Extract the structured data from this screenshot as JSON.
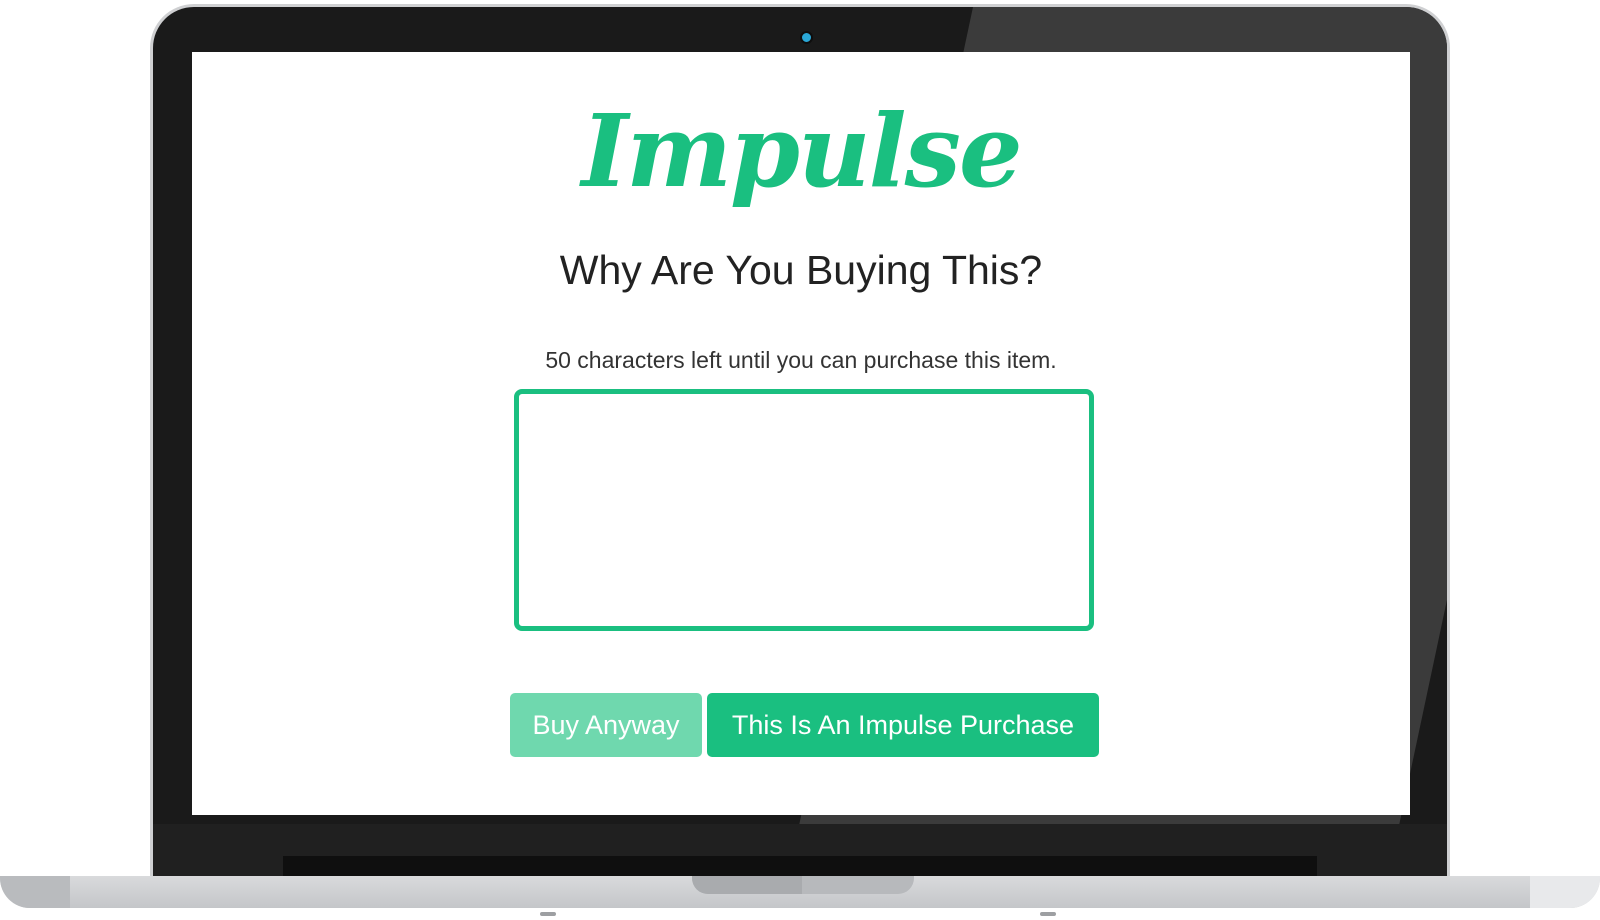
{
  "app": {
    "logo_text": "Impulse",
    "brand_color": "#1abf80",
    "brand_color_light": "#6fd8ae"
  },
  "main": {
    "headline": "Why Are You Buying This?",
    "hint": "50 characters left until you can purchase this item.",
    "reason_input": {
      "value": "",
      "placeholder": ""
    }
  },
  "actions": {
    "buy_anyway_label": "Buy Anyway",
    "impulse_label": "This Is An Impulse Purchase"
  }
}
